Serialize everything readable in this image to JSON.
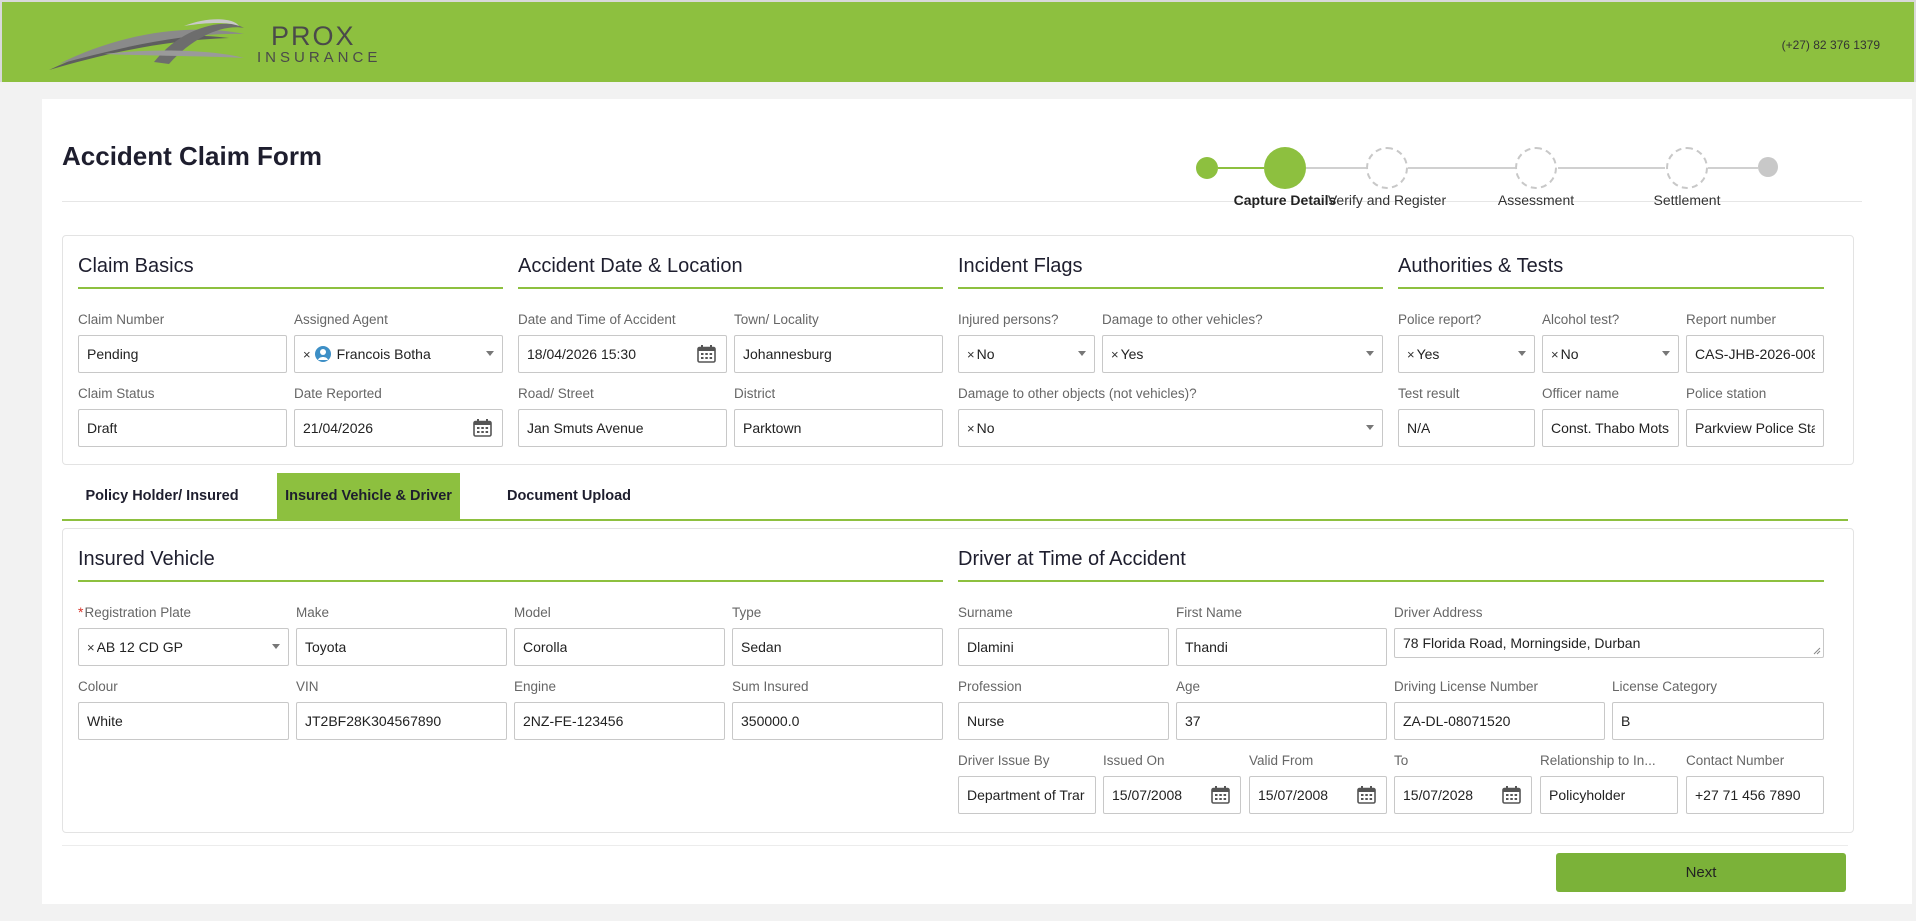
{
  "header": {
    "brand_main": "PROX",
    "brand_sub": "INSURANCE",
    "phone": "(+27) 82 376 1379",
    "accent": "#8dc03f"
  },
  "page": {
    "title": "Accident Claim Form"
  },
  "stepper": {
    "steps": [
      "Capture Details",
      "Verify and Register",
      "Assessment",
      "Settlement"
    ],
    "active_index": 0
  },
  "claim_basics": {
    "title": "Claim Basics",
    "claim_number": {
      "label": "Claim Number",
      "value": "Pending"
    },
    "assigned_agent": {
      "label": "Assigned Agent",
      "value": "Francois Botha"
    },
    "claim_status": {
      "label": "Claim Status",
      "value": "Draft"
    },
    "date_reported": {
      "label": "Date Reported",
      "value": "21/04/2026"
    }
  },
  "accident": {
    "title": "Accident Date & Location",
    "datetime": {
      "label": "Date and Time of Accident",
      "value": "18/04/2026 15:30"
    },
    "town": {
      "label": "Town/ Locality",
      "value": "Johannesburg"
    },
    "road": {
      "label": "Road/ Street",
      "value": "Jan Smuts Avenue"
    },
    "district": {
      "label": "District",
      "value": "Parktown"
    }
  },
  "incident": {
    "title": "Incident Flags",
    "injured": {
      "label": "Injured persons?",
      "value": "No"
    },
    "damage_vehicles": {
      "label": "Damage to other vehicles?",
      "value": "Yes"
    },
    "damage_objects": {
      "label": "Damage to other objects (not vehicles)?",
      "value": "No"
    }
  },
  "authorities": {
    "title": "Authorities & Tests",
    "police_report": {
      "label": "Police report?",
      "value": "Yes"
    },
    "alcohol_test": {
      "label": "Alcohol test?",
      "value": "No"
    },
    "report_number": {
      "label": "Report number",
      "value": "CAS-JHB-2026-008"
    },
    "test_result": {
      "label": "Test result",
      "value": "N/A"
    },
    "officer_name": {
      "label": "Officer name",
      "value": "Const. Thabo Mots"
    },
    "police_station": {
      "label": "Police station",
      "value": "Parkview Police Sta"
    }
  },
  "tabs": [
    "Policy Holder/ Insured",
    "Insured Vehicle & Driver",
    "Document Upload"
  ],
  "vehicle": {
    "title": "Insured Vehicle",
    "reg_plate": {
      "label": "Registration Plate",
      "value": "AB 12 CD GP"
    },
    "make": {
      "label": "Make",
      "value": "Toyota"
    },
    "model": {
      "label": "Model",
      "value": "Corolla"
    },
    "type": {
      "label": "Type",
      "value": "Sedan"
    },
    "colour": {
      "label": "Colour",
      "value": "White"
    },
    "vin": {
      "label": "VIN",
      "value": "JT2BF28K304567890"
    },
    "engine": {
      "label": "Engine",
      "value": "2NZ-FE-123456"
    },
    "sum_insured": {
      "label": "Sum Insured",
      "value": "350000.0"
    }
  },
  "driver": {
    "title": "Driver at Time of Accident",
    "surname": {
      "label": "Surname",
      "value": "Dlamini"
    },
    "first_name": {
      "label": "First Name",
      "value": "Thandi"
    },
    "address": {
      "label": "Driver Address",
      "value": "78 Florida Road, Morningside, Durban"
    },
    "profession": {
      "label": "Profession",
      "value": "Nurse"
    },
    "age": {
      "label": "Age",
      "value": "37"
    },
    "license_number": {
      "label": "Driving License Number",
      "value": "ZA-DL-08071520"
    },
    "license_category": {
      "label": "License Category",
      "value": "B"
    },
    "issue_by": {
      "label": "Driver Issue By",
      "value": "Department of Trar"
    },
    "issued_on": {
      "label": "Issued On",
      "value": "15/07/2008"
    },
    "valid_from": {
      "label": "Valid From",
      "value": "15/07/2008"
    },
    "valid_to": {
      "label": "To",
      "value": "15/07/2028"
    },
    "relationship": {
      "label": "Relationship to In...",
      "value": "Policyholder"
    },
    "contact": {
      "label": "Contact Number",
      "value": "+27 71 456 7890"
    }
  },
  "footer": {
    "next_label": "Next"
  }
}
